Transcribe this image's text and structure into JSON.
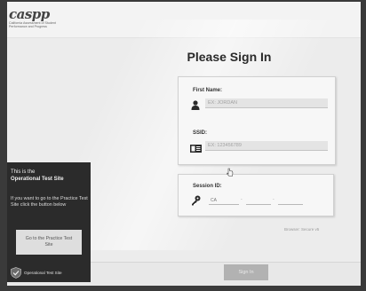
{
  "header": {
    "logo_text": "caspp",
    "logo_subtitle": "California Assessment of Student Performance and Progress"
  },
  "page": {
    "title": "Please Sign In"
  },
  "form": {
    "first_name": {
      "label": "First Name:",
      "placeholder": "EX: JORDAN"
    },
    "ssid": {
      "label": "SSID:",
      "placeholder": "EX: 123456789"
    },
    "session_id": {
      "label": "Session ID:",
      "prefix_placeholder": "CA",
      "separator": "-"
    }
  },
  "browser_note": "Browser: Secure v5",
  "signin_button": "Sign In",
  "practice_panel": {
    "line1": "This is the",
    "line2": "Operational Test Site",
    "body": "If you want to go to the Practice Test Site click the button below",
    "button": "Go to the Practice Test Site",
    "footer_label": "Operational Test Site"
  },
  "colors": {
    "panel_dark": "#2b2b2b",
    "button_gray": "#b2b2b2",
    "card_bg": "#f7f7f7"
  },
  "icons": [
    "person-icon",
    "id-card-icon",
    "key-icon",
    "shield-check-icon",
    "cursor-icon"
  ]
}
